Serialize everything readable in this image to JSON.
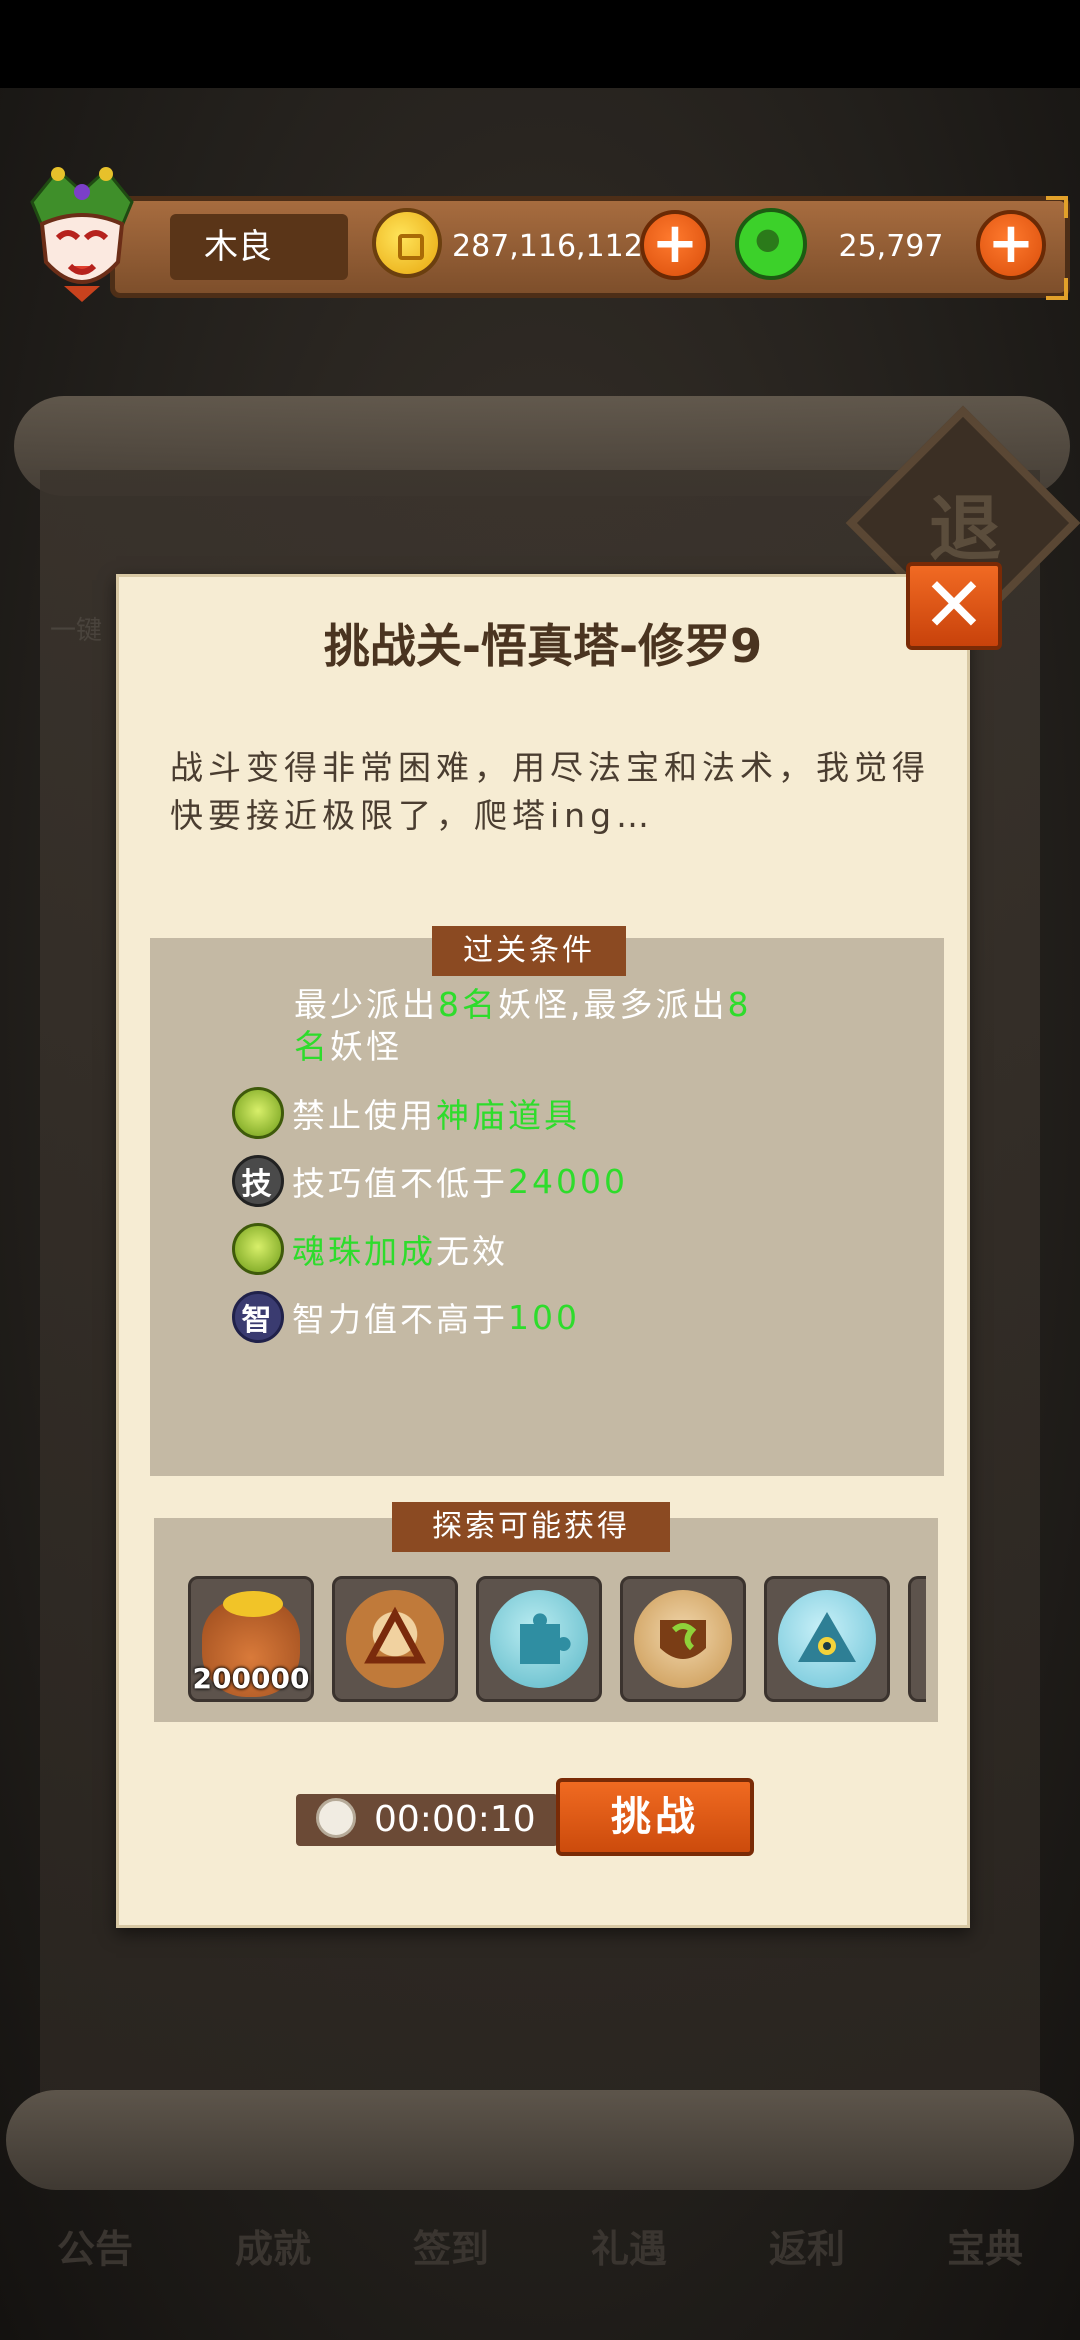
{
  "background": {
    "exit_label": "退",
    "onekey_label": "一键",
    "bottom_nav": [
      "公告",
      "成就",
      "签到",
      "礼遇",
      "返利",
      "宝典"
    ]
  },
  "hud": {
    "player_name": "木良",
    "gold_value": "287,116,112",
    "jade_value": "25,797",
    "plus_label": "+"
  },
  "modal": {
    "title": "挑战关-悟真塔-修罗9",
    "close_label": "✕",
    "description": "战斗变得非常困难，用尽法宝和法术，我觉得快要接近极限了，爬塔ing…",
    "conditions_header": "过关条件",
    "condition_first": {
      "a": "最少派出",
      "b": "8名",
      "c": "妖怪,最多派出",
      "d": "8",
      "e": "名",
      "f": "妖怪"
    },
    "conditions": [
      {
        "icon": "soul-orb-icon",
        "icon_text": "",
        "prefix": "禁止使用",
        "highlight": "神庙道具",
        "suffix": ""
      },
      {
        "icon": "skill-icon",
        "icon_text": "技",
        "prefix": "技巧值不低于",
        "highlight": "24000",
        "suffix": ""
      },
      {
        "icon": "soul-orb-icon",
        "icon_text": "",
        "prefix": "",
        "highlight": "魂珠加成",
        "suffix": "无效"
      },
      {
        "icon": "wisdom-icon",
        "icon_text": "智",
        "prefix": "智力值不高于",
        "highlight": "100",
        "suffix": ""
      }
    ],
    "rewards_header": "探索可能获得",
    "rewards": [
      {
        "name": "gold-bag-icon",
        "qty": "200000"
      },
      {
        "name": "triangle-rune-orb-icon",
        "qty": ""
      },
      {
        "name": "puzzle-orb-icon",
        "qty": ""
      },
      {
        "name": "shield-rune-orb-icon",
        "qty": ""
      },
      {
        "name": "eye-triangle-orb-icon",
        "qty": ""
      }
    ],
    "timer": "00:00:10",
    "challenge_label": "挑战"
  },
  "colors": {
    "highlight_green": "#2edc2c",
    "button_orange": "#e35a16",
    "parchment": "#f6ecd3",
    "panel_grey": "#c4b9a4"
  }
}
